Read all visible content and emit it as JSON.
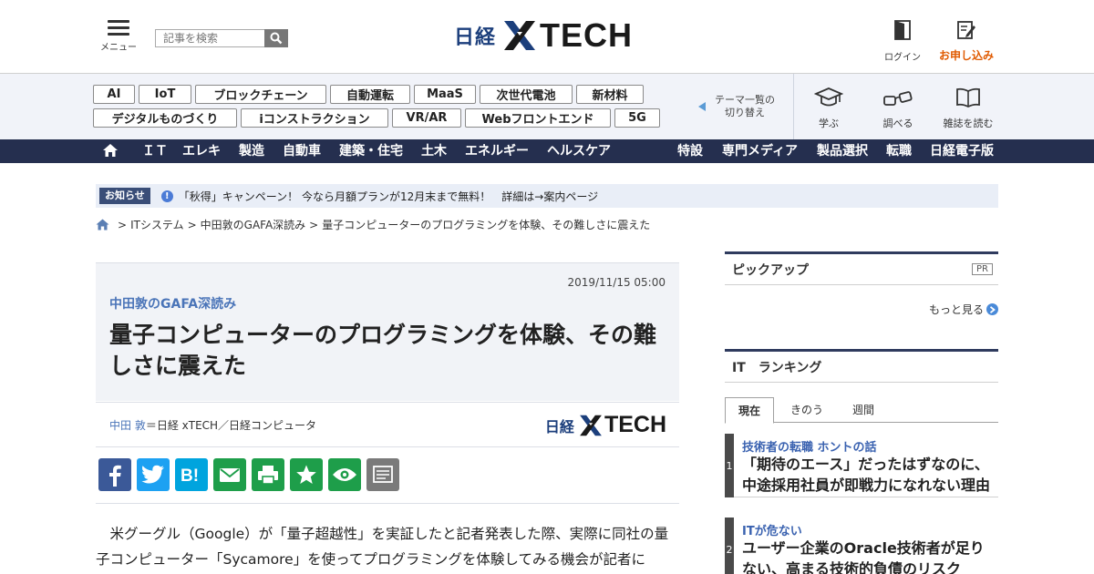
{
  "header": {
    "menu_label": "メニュー",
    "search_placeholder": "記事を検索",
    "logo_nikkei": "日経",
    "logo_tech": "TECH",
    "login_label": "ログイン",
    "apply_label": "お申し込み"
  },
  "tags": {
    "row1": [
      "AI",
      "IoT",
      "ブロックチェーン",
      "自動運転",
      "MaaS",
      "次世代電池",
      "新材料"
    ],
    "row2": [
      "デジタルものづくり",
      "iコンストラクション",
      "VR/AR",
      "Webフロントエンド",
      "5G"
    ]
  },
  "theme_switch": {
    "line1": "テーマ一覧の",
    "line2": "切り替え"
  },
  "tools": {
    "learn": "学ぶ",
    "search": "調べる",
    "magazine": "雑誌を読む"
  },
  "nav": {
    "left": [
      "ＩＴ",
      "エレキ",
      "製造",
      "自動車",
      "建築・住宅",
      "土木",
      "エネルギー",
      "ヘルスケア"
    ],
    "right": [
      "特設",
      "専門メディア",
      "製品選択",
      "転職",
      "日経電子版"
    ]
  },
  "notice": {
    "badge": "お知らせ",
    "text": "「秋得」キャンペーン！ 今なら月額プランが12月末まで無料！　詳細は→案内ページ"
  },
  "breadcrumb": [
    "ITシステム",
    "中田敦のGAFA深読み",
    "量子コンピューターのプログラミングを体験、その難しさに震えた"
  ],
  "article": {
    "date": "2019/11/15 05:00",
    "series": "中田敦のGAFA深読み",
    "title": "量子コンピューターのプログラミングを体験、その難しさに震えた",
    "author_name": "中田 敦",
    "author_affil": "＝日経 xTECH／日経コンピュータ",
    "body": "米グーグル（Google）が「量子超越性」を実証したと記者発表した際、実際に同社の量子コンピューター「Sycamore」を使ってプログラミングを体験してみる機会が記者に"
  },
  "pickup": {
    "title": "ピックアップ",
    "pr": "PR",
    "more": "もっと見る"
  },
  "ranking": {
    "title": "IT　ランキング",
    "tabs": [
      "現在",
      "きのう",
      "週間"
    ],
    "items": [
      {
        "rank": "1",
        "category": "技術者の転職 ホントの話",
        "title": "「期待のエース」だったはずなのに、中途採用社員が即戦力になれない理由"
      },
      {
        "rank": "2",
        "category": "ITが危ない",
        "title": "ユーザー企業のOracle技術者が足りない、高まる技術的負債のリスク"
      }
    ]
  },
  "colors": {
    "brand_navy": "#252f4f",
    "accent_orange": "#e05a00",
    "link_blue": "#4a74b8"
  }
}
